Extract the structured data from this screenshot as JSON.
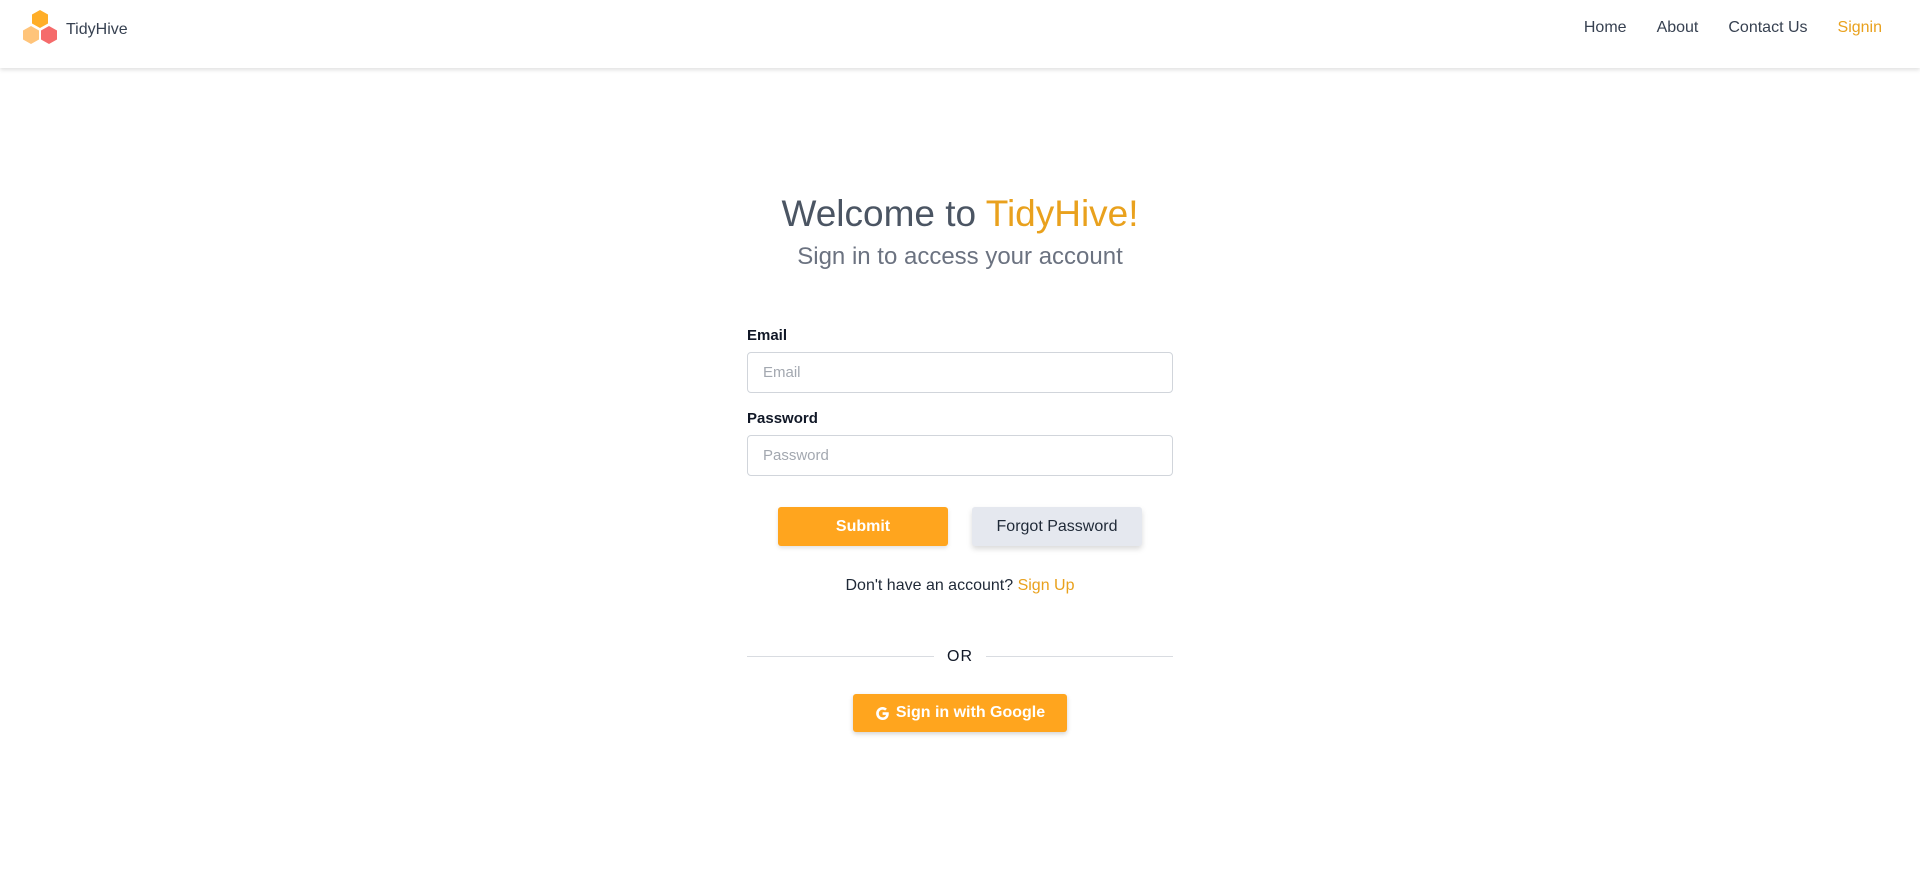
{
  "header": {
    "brand_name": "TidyHive",
    "logo_icon": "honeycomb-logo-icon",
    "nav": [
      {
        "label": "Home"
      },
      {
        "label": "About"
      },
      {
        "label": "Contact Us"
      },
      {
        "label": "Signin",
        "active": true
      }
    ]
  },
  "main": {
    "welcome_prefix": "Welcome to ",
    "welcome_brand": "TidyHive!",
    "subtitle": "Sign in to access your account",
    "form": {
      "email": {
        "label": "Email",
        "placeholder": "Email",
        "value": ""
      },
      "password": {
        "label": "Password",
        "placeholder": "Password",
        "value": ""
      },
      "submit_label": "Submit",
      "forgot_label": "Forgot Password"
    },
    "signup_prompt": "Don't have an account? ",
    "signup_link": "Sign Up",
    "divider_text": "OR",
    "google_label": "Sign in with Google",
    "google_icon": "google-g-icon"
  },
  "colors": {
    "accent": "#ffa51e",
    "accent_text": "#e9a11d",
    "secondary_button": "#e5e8ef",
    "logo_orange": "#ffae28",
    "logo_peach": "#ffc47a",
    "logo_red": "#f56b6b"
  }
}
